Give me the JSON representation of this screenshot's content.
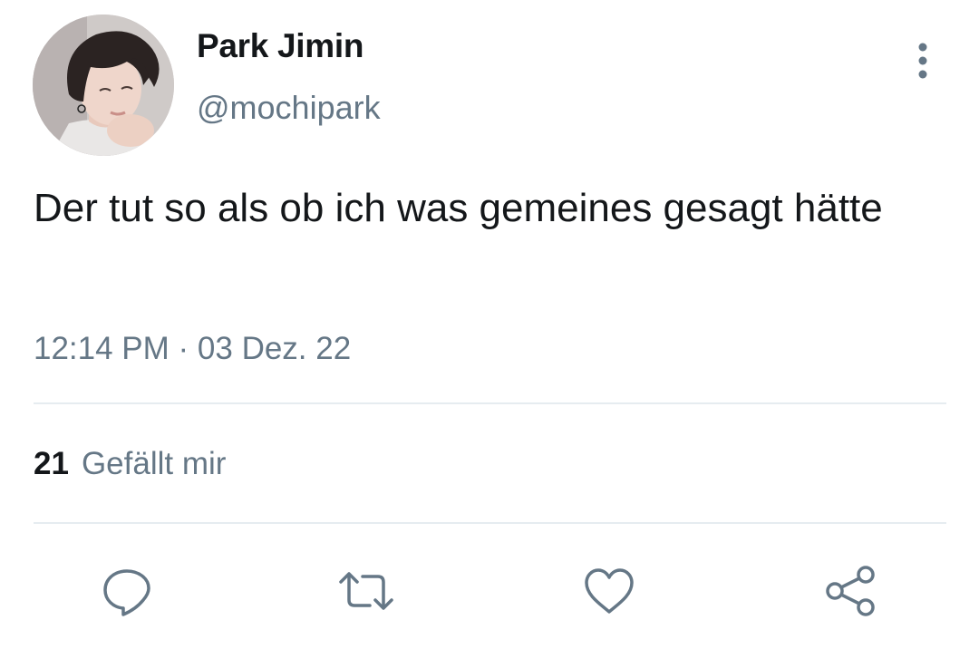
{
  "author": {
    "display_name": "Park Jimin",
    "handle": "@mochipark",
    "avatar_icon": "profile-photo"
  },
  "tweet": {
    "text": "Der tut so als ob ich was gemeines gesagt hätte",
    "timestamp": "12:14 PM · 03 Dez. 22"
  },
  "stats": {
    "likes_count": "21",
    "likes_label": "Gefällt mir"
  },
  "menu": {
    "icon": "more-vertical-icon"
  },
  "actions": {
    "reply_icon": "reply-icon",
    "retweet_icon": "retweet-icon",
    "like_icon": "heart-icon",
    "share_icon": "share-icon"
  },
  "colors": {
    "text_primary": "#14171a",
    "text_secondary": "#657786",
    "divider": "#e6ecf0"
  }
}
